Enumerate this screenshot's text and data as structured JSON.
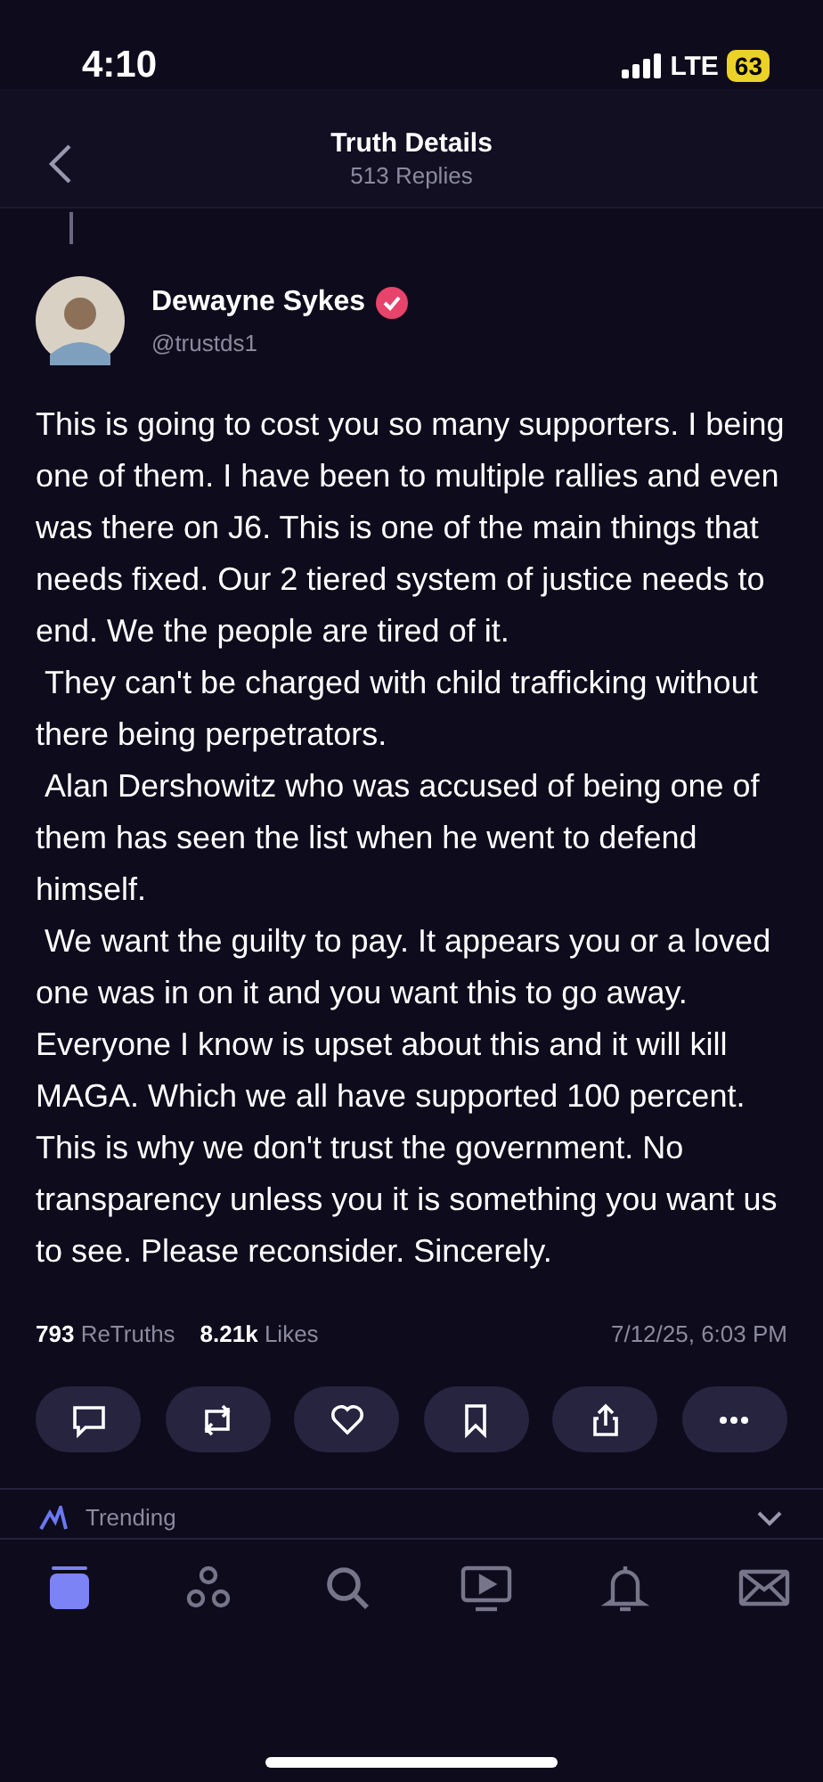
{
  "status_bar": {
    "time": "4:10",
    "network": "LTE",
    "battery": "63"
  },
  "header": {
    "title": "Truth Details",
    "subtitle": "513 Replies"
  },
  "post": {
    "author": "Dewayne Sykes",
    "verified": true,
    "handle": "@trustds1",
    "paragraphs": [
      "This is going to cost you so many supporters. I being one of them. I have been to multiple rallies and even was there on J6. This is one of the main things that needs fixed. Our 2 tiered system of justice needs to end. We the people are tired of it.",
      " They can't be charged with child trafficking without there being perpetrators.",
      " Alan Dershowitz who was accused of being one of them has seen the list when he went to defend himself.",
      " We want the guilty to pay. It appears you or a loved one was in on it and you want this to go away. Everyone I know is upset about this and it will kill MAGA. Which we all have supported 100 percent. This is why we don't trust the government. No transparency unless you it is something you want us to see. Please reconsider. Sincerely."
    ],
    "stats": [
      {
        "count": "793",
        "label": "ReTruths"
      },
      {
        "count": "8.21k",
        "label": "Likes"
      }
    ],
    "timestamp": "7/12/25, 6:03 PM",
    "actions": [
      {
        "kind": "reply"
      },
      {
        "kind": "retruth"
      },
      {
        "kind": "like"
      },
      {
        "kind": "bookmark"
      },
      {
        "kind": "share"
      },
      {
        "kind": "more"
      }
    ]
  },
  "trending": {
    "label": "Trending"
  },
  "tab_bar": [
    {
      "kind": "home",
      "selected": true
    },
    {
      "kind": "groups",
      "selected": false
    },
    {
      "kind": "search",
      "selected": false
    },
    {
      "kind": "video",
      "selected": false
    },
    {
      "kind": "notifications",
      "selected": false
    },
    {
      "kind": "messages",
      "selected": false
    }
  ]
}
